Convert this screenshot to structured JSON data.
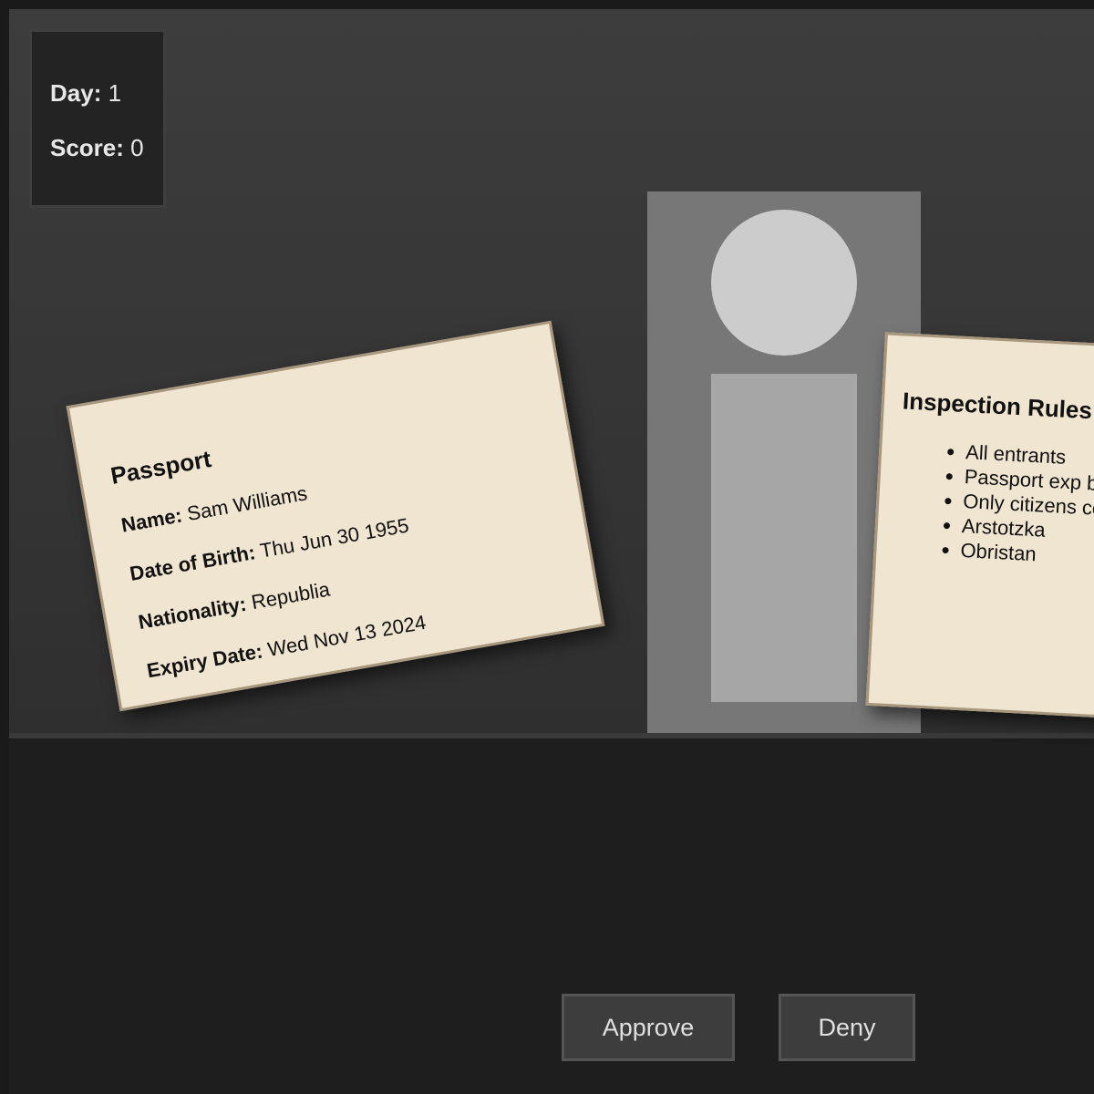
{
  "hud": {
    "day_label": "Day:",
    "day_value": "1",
    "score_label": "Score:",
    "score_value": "0"
  },
  "passport": {
    "title": "Passport",
    "fields": [
      {
        "label": "Name:",
        "value": "Sam Williams"
      },
      {
        "label": "Date of Birth:",
        "value": "Thu Jun 30 1955"
      },
      {
        "label": "Nationality:",
        "value": "Republia"
      },
      {
        "label": "Expiry Date:",
        "value": "Wed Nov 13 2024"
      }
    ]
  },
  "rules": {
    "title": "Inspection Rules",
    "items": [
      "All entrants",
      "Passport exp before today",
      "Only citizens countries are",
      "Arstotzka",
      "Obristan"
    ]
  },
  "actions": {
    "approve_label": "Approve",
    "deny_label": "Deny"
  },
  "colors": {
    "paper": "#f0e5d1",
    "paper_border": "#a8977c",
    "booth": "#3d3d3d",
    "floor": "#1e1e1e"
  }
}
